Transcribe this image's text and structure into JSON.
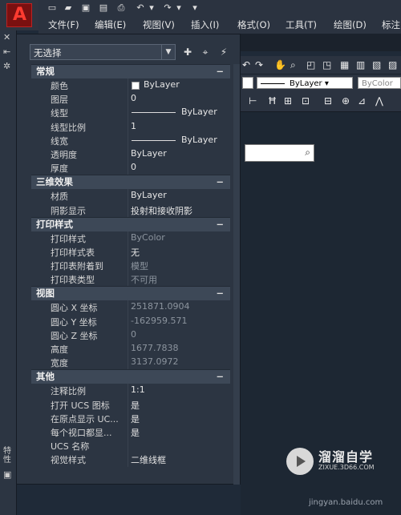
{
  "menubar": [
    "文件(F)",
    "编辑(E)",
    "视图(V)",
    "插入(I)",
    "格式(O)",
    "工具(T)",
    "绘图(D)",
    "标注"
  ],
  "toolbar": {
    "linetype_value": "ByLayer",
    "color_value": "ByColor"
  },
  "left_strip": {
    "vertical_label": "特性"
  },
  "panel": {
    "selection": "无选择",
    "sections": [
      {
        "title": "常规",
        "rows": [
          {
            "key": "颜色",
            "value": "ByLayer"
          },
          {
            "key": "图层",
            "value": "0"
          },
          {
            "key": "线型",
            "value": "ByLayer"
          },
          {
            "key": "线型比例",
            "value": "1"
          },
          {
            "key": "线宽",
            "value": "ByLayer"
          },
          {
            "key": "透明度",
            "value": "ByLayer"
          },
          {
            "key": "厚度",
            "value": "0"
          }
        ]
      },
      {
        "title": "三维效果",
        "rows": [
          {
            "key": "材质",
            "value": "ByLayer"
          },
          {
            "key": "阴影显示",
            "value": "投射和接收阴影"
          }
        ]
      },
      {
        "title": "打印样式",
        "rows": [
          {
            "key": "打印样式",
            "value": "ByColor"
          },
          {
            "key": "打印样式表",
            "value": "无"
          },
          {
            "key": "打印表附着到",
            "value": "模型"
          },
          {
            "key": "打印表类型",
            "value": "不可用"
          }
        ]
      },
      {
        "title": "视图",
        "rows": [
          {
            "key": "圆心 X 坐标",
            "value": "251871.0904"
          },
          {
            "key": "圆心 Y 坐标",
            "value": "-162959.571"
          },
          {
            "key": "圆心 Z 坐标",
            "value": "0"
          },
          {
            "key": "高度",
            "value": "1677.7838"
          },
          {
            "key": "宽度",
            "value": "3137.0972"
          }
        ]
      },
      {
        "title": "其他",
        "rows": [
          {
            "key": "注释比例",
            "value": "1:1"
          },
          {
            "key": "打开 UCS 图标",
            "value": "是"
          },
          {
            "key": "在原点显示 UC...",
            "value": "是"
          },
          {
            "key": "每个视口都显...",
            "value": "是"
          },
          {
            "key": "UCS 名称",
            "value": ""
          },
          {
            "key": "视觉样式",
            "value": "二维线框"
          }
        ]
      }
    ]
  },
  "watermark": {
    "title": "溜溜自学",
    "subtitle": "ZIXUE.3D66.COM",
    "site": "jingyan.baidu.com"
  }
}
